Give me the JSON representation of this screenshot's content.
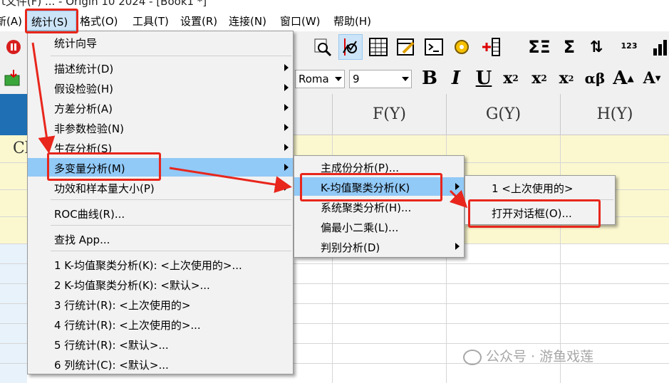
{
  "window": {
    "title": "t文件(F) ... - Origin 10 2024 - [Book1 *]"
  },
  "menubar": {
    "items": [
      {
        "label": "新(A)"
      },
      {
        "label": "统计(S)"
      },
      {
        "label": "格式(O)"
      },
      {
        "label": "工具(T)"
      },
      {
        "label": "设置(R)"
      },
      {
        "label": "连接(N)"
      },
      {
        "label": "窗口(W)"
      },
      {
        "label": "帮助(H)"
      }
    ]
  },
  "format_toolbar": {
    "font_name": "Roma",
    "font_size": "9",
    "bold": "B",
    "italic": "I",
    "underline": "U",
    "greek": "αβ"
  },
  "worksheet": {
    "columns": [
      "F(Y)",
      "G(Y)",
      "H(Y)"
    ],
    "first_cell_fragment": "Cl"
  },
  "stats_menu": {
    "items": [
      {
        "label": "统计向导",
        "arrow": false
      },
      {
        "label": "描述统计(D)",
        "arrow": true
      },
      {
        "label": "假设检验(H)",
        "arrow": true
      },
      {
        "label": "方差分析(A)",
        "arrow": true
      },
      {
        "label": "非参数检验(N)",
        "arrow": true
      },
      {
        "label": "生存分析(S)",
        "arrow": true
      },
      {
        "label": "多变量分析(M)",
        "arrow": true
      },
      {
        "label": "功效和样本量大小(P)",
        "arrow": true
      },
      {
        "label": "ROC曲线(R)...",
        "arrow": false
      },
      {
        "label": "查找 App...",
        "arrow": false
      },
      {
        "label": "1 K-均值聚类分析(K): <上次使用的>...",
        "arrow": false
      },
      {
        "label": "2 K-均值聚类分析(K): <默认>...",
        "arrow": false
      },
      {
        "label": "3 行统计(R): <上次使用的>",
        "arrow": false
      },
      {
        "label": "4 行统计(R): <上次使用的>...",
        "arrow": false
      },
      {
        "label": "5 行统计(R): <默认>...",
        "arrow": false
      },
      {
        "label": "6 列统计(C): <默认>...",
        "arrow": false
      }
    ]
  },
  "multivariate_menu": {
    "items": [
      {
        "label": "主成份分析(P)...",
        "arrow": false
      },
      {
        "label": "K-均值聚类分析(K)",
        "arrow": true
      },
      {
        "label": "系统聚类分析(H)...",
        "arrow": false
      },
      {
        "label": "偏最小二乘(L)...",
        "arrow": false
      },
      {
        "label": "判别分析(D)",
        "arrow": true
      }
    ]
  },
  "kmeans_menu": {
    "items": [
      {
        "label": "1 <上次使用的>"
      },
      {
        "label": "打开对话框(O)..."
      }
    ]
  },
  "watermark": {
    "text": "公众号 · 游鱼戏莲"
  },
  "colors": {
    "highlight": "#91c9f7",
    "annotation_red": "#e8261c",
    "header_blue": "#1e6fb3",
    "cell_yellow": "#fbf8cf"
  }
}
